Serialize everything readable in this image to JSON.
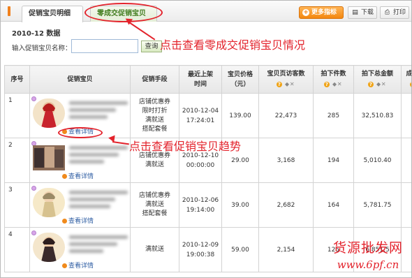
{
  "tabs": [
    {
      "label": "促销宝贝明细",
      "active": true
    },
    {
      "label": "零成交促销宝贝",
      "active": false
    }
  ],
  "toolbar": {
    "more_label": "更多指标",
    "download_label": "下载",
    "print_label": "打印"
  },
  "month_label": "2010-12 数据",
  "search": {
    "label": "输入促销宝贝名称：",
    "value": "",
    "button_label": "查询"
  },
  "columns": [
    "序号",
    "促销宝贝",
    "促销手段",
    "最近上架\n时间",
    "宝贝价格\n（元）",
    "宝贝页访客数",
    "拍下件数",
    "拍下总金额",
    "成交"
  ],
  "detail_label": "查看详情",
  "rows": [
    {
      "idx": "1",
      "promo": "店铺优惠券\n限时打折\n满就送\n搭配套餐",
      "time": "2010-12-04\n17:24:01",
      "price": "139.00",
      "visitors": "22,473",
      "units": "285",
      "amount": "32,510.83"
    },
    {
      "idx": "2",
      "promo": "店铺优惠券\n满就送",
      "time": "2010-12-10\n00:00:00",
      "price": "29.00",
      "visitors": "3,168",
      "units": "194",
      "amount": "5,010.40"
    },
    {
      "idx": "3",
      "promo": "店铺优惠券\n满就送\n搭配套餐",
      "time": "2010-12-06\n19:14:00",
      "price": "39.00",
      "visitors": "2,682",
      "units": "164",
      "amount": "5,781.75"
    },
    {
      "idx": "4",
      "promo": "满就送",
      "time": "2010-12-09\n19:00:38",
      "price": "59.00",
      "visitors": "2,154",
      "units": "125",
      "amount": "6,851.5"
    }
  ],
  "annotations": {
    "zero_sales": "点击查看零成交促销宝贝情况",
    "trend": "点击查看促销宝贝趋势"
  },
  "watermark": {
    "line1": "货源批发网",
    "line2": "www.6pf.cn"
  },
  "colors": {
    "annotation_red": "#e3232c",
    "orange_button": "#f3870f",
    "link_blue": "#2f5ea3"
  }
}
